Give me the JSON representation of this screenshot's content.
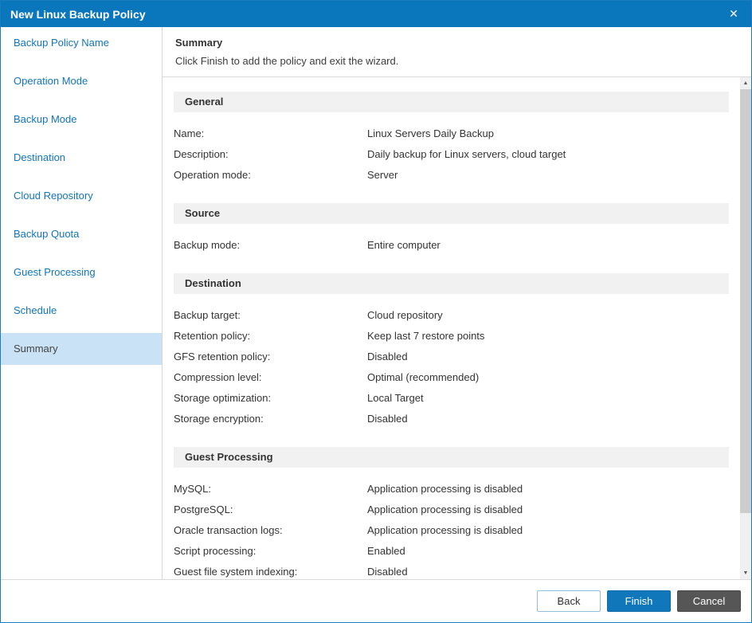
{
  "window": {
    "title": "New Linux Backup Policy"
  },
  "icons": {
    "close": "✕",
    "scroll_up": "▲",
    "scroll_down": "▼"
  },
  "colors": {
    "titlebar": "#0a77bd",
    "accent": "#1177bb",
    "active_item_bg": "#c9e2f5",
    "section_header_bg": "#f1f1f1",
    "cancel_bg": "#565656"
  },
  "sidebar": {
    "items": [
      {
        "label": "Backup Policy Name",
        "active": false
      },
      {
        "label": "Operation Mode",
        "active": false
      },
      {
        "label": "Backup Mode",
        "active": false
      },
      {
        "label": "Destination",
        "active": false
      },
      {
        "label": "Cloud Repository",
        "active": false
      },
      {
        "label": "Backup Quota",
        "active": false
      },
      {
        "label": "Guest Processing",
        "active": false
      },
      {
        "label": "Schedule",
        "active": false
      },
      {
        "label": "Summary",
        "active": true
      }
    ]
  },
  "header": {
    "title": "Summary",
    "subtitle": "Click Finish to add the policy and exit the wizard."
  },
  "sections": [
    {
      "title": "General",
      "rows": [
        {
          "label": "Name:",
          "value": "Linux Servers Daily Backup"
        },
        {
          "label": "Description:",
          "value": "Daily backup for Linux servers, cloud target"
        },
        {
          "label": "Operation mode:",
          "value": "Server"
        }
      ]
    },
    {
      "title": "Source",
      "rows": [
        {
          "label": "Backup mode:",
          "value": "Entire computer"
        }
      ]
    },
    {
      "title": "Destination",
      "rows": [
        {
          "label": "Backup target:",
          "value": "Cloud repository"
        },
        {
          "label": "Retention policy:",
          "value": "Keep last 7 restore points"
        },
        {
          "label": "GFS retention policy:",
          "value": "Disabled"
        },
        {
          "label": "Compression level:",
          "value": "Optimal (recommended)"
        },
        {
          "label": "Storage optimization:",
          "value": "Local Target"
        },
        {
          "label": "Storage encryption:",
          "value": "Disabled"
        }
      ]
    },
    {
      "title": "Guest Processing",
      "rows": [
        {
          "label": "MySQL:",
          "value": "Application processing is disabled"
        },
        {
          "label": "PostgreSQL:",
          "value": "Application processing is disabled"
        },
        {
          "label": "Oracle transaction logs:",
          "value": "Application processing is disabled"
        },
        {
          "label": "Script processing:",
          "value": "Enabled"
        },
        {
          "label": "Guest file system indexing:",
          "value": "Disabled"
        }
      ]
    }
  ],
  "footer": {
    "back_label": "Back",
    "finish_label": "Finish",
    "cancel_label": "Cancel"
  }
}
